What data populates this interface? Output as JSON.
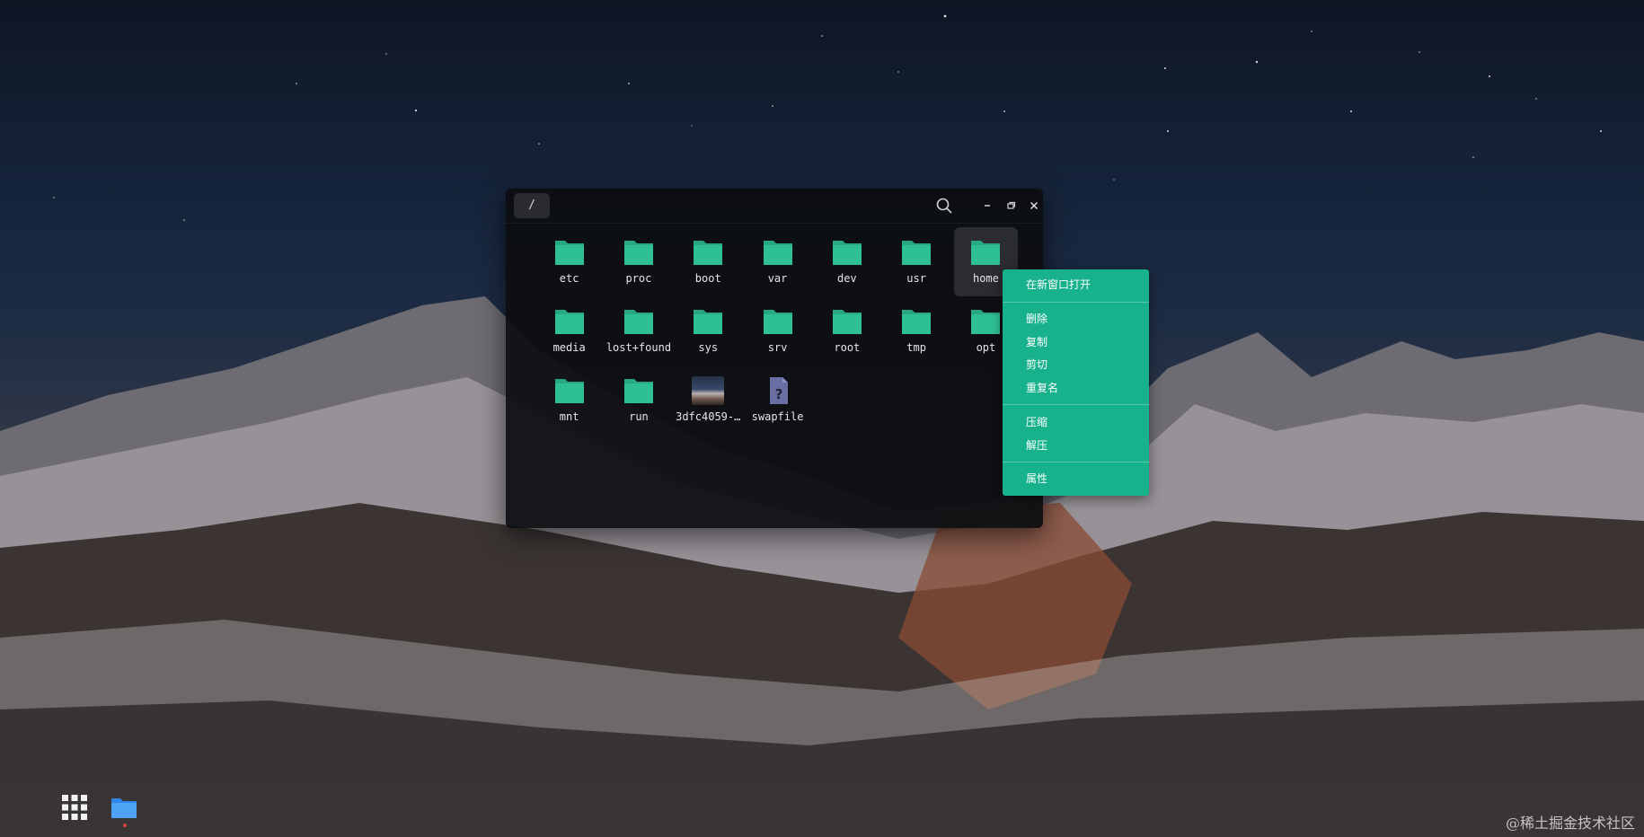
{
  "window": {
    "path": "/",
    "buttons": {
      "search": "search-icon",
      "minimize": "minimize-icon",
      "maximize": "maximize-icon",
      "close": "close-icon"
    }
  },
  "files": [
    {
      "name": "etc",
      "type": "folder"
    },
    {
      "name": "proc",
      "type": "folder"
    },
    {
      "name": "boot",
      "type": "folder"
    },
    {
      "name": "var",
      "type": "folder"
    },
    {
      "name": "dev",
      "type": "folder"
    },
    {
      "name": "usr",
      "type": "folder"
    },
    {
      "name": "home",
      "type": "folder",
      "selected": true
    },
    {
      "name": "media",
      "type": "folder"
    },
    {
      "name": "lost+found",
      "type": "folder"
    },
    {
      "name": "sys",
      "type": "folder"
    },
    {
      "name": "srv",
      "type": "folder"
    },
    {
      "name": "root",
      "type": "folder"
    },
    {
      "name": "tmp",
      "type": "folder"
    },
    {
      "name": "opt",
      "type": "folder"
    },
    {
      "name": "mnt",
      "type": "folder"
    },
    {
      "name": "run",
      "type": "folder"
    },
    {
      "name": "3dfc4059-…",
      "type": "image"
    },
    {
      "name": "swapfile",
      "type": "unknown"
    }
  ],
  "context_menu": {
    "items": [
      "在新窗口打开",
      "删除",
      "复制",
      "剪切",
      "重复名",
      "压缩",
      "解压",
      "属性"
    ]
  },
  "dock": {
    "apps": "app-grid-icon",
    "files": "folder-icon"
  },
  "watermark": "@稀土掘金技术社区",
  "colors": {
    "accent": "#17b28b",
    "folder": "#2fbf94",
    "window_bg": "#0c0d10"
  }
}
